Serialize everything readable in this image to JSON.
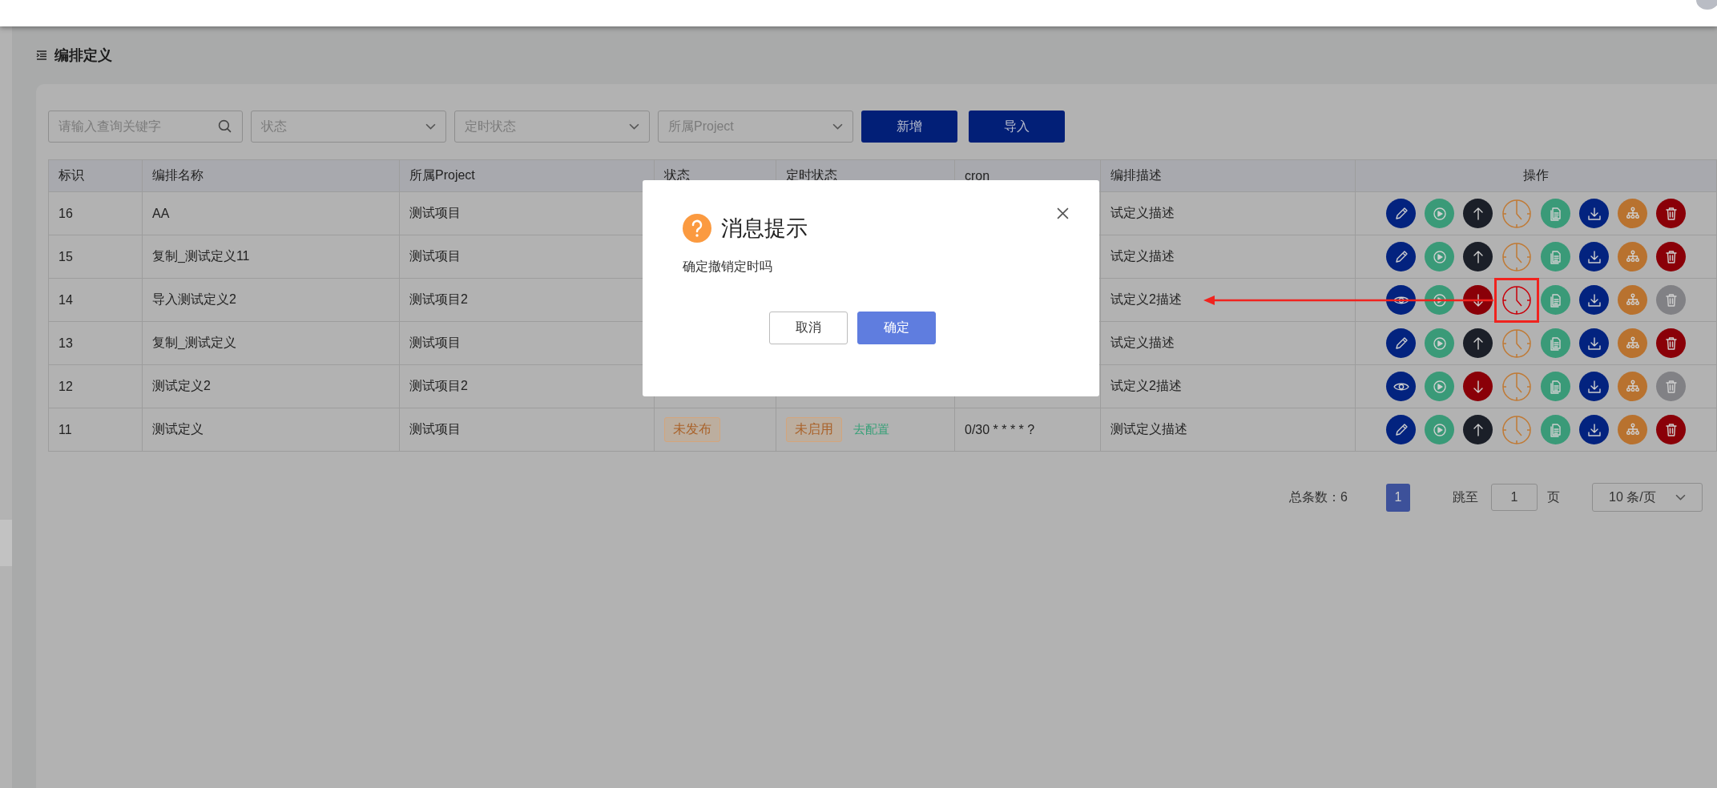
{
  "page_title": "编排定义",
  "filters": {
    "search": {
      "placeholder": "请输入查询关键字"
    },
    "selects": [
      {
        "placeholder": "状态"
      },
      {
        "placeholder": "定时状态"
      },
      {
        "placeholder": "所属Project"
      }
    ]
  },
  "buttons": [
    "新增",
    "导入"
  ],
  "table": {
    "columns": [
      "标识",
      "编排名称",
      "所属Project",
      "状态",
      "定时状态",
      "cron",
      "编排描述",
      "操作"
    ],
    "rows": [
      {
        "id": "16",
        "name": "AA",
        "project": "测试项目",
        "description": "试定义描述",
        "editable": true,
        "published": false,
        "clock_highlighted": false,
        "deletable": true
      },
      {
        "id": "15",
        "name": "复制_测试定义11",
        "project": "测试项目",
        "description": "试定义描述",
        "editable": true,
        "published": false,
        "clock_highlighted": false,
        "deletable": true
      },
      {
        "id": "14",
        "name": "导入测试定义2",
        "project": "测试项目2",
        "description": "试定义2描述",
        "editable": false,
        "published": true,
        "clock_highlighted": true,
        "deletable": false
      },
      {
        "id": "13",
        "name": "复制_测试定义",
        "project": "测试项目",
        "description": "试定义描述",
        "editable": true,
        "published": false,
        "clock_highlighted": false,
        "deletable": true
      },
      {
        "id": "12",
        "name": "测试定义2",
        "project": "测试项目2",
        "description": "试定义2描述",
        "editable": false,
        "published": true,
        "clock_highlighted": false,
        "deletable": false
      },
      {
        "id": "11",
        "name": "测试定义",
        "project": "测试项目",
        "status": "未发布",
        "timer_status": "未启用",
        "timer_link": "去配置",
        "cron": "0/30 * * * * ?",
        "description": "测试定义描述",
        "editable": true,
        "published": false,
        "clock_highlighted": false,
        "deletable": true
      }
    ]
  },
  "pagination": {
    "total": "总条数：6",
    "pages": [
      {
        "label": "1",
        "selected": true
      }
    ],
    "jump_label": "跳至",
    "jump_value": "1",
    "page_suffix": "页",
    "page_size": "10 条/页"
  },
  "dialog": {
    "title": "消息提示",
    "message": "确定撤销定时吗",
    "buttons": [
      {
        "label": "取消",
        "kind": "secondary"
      },
      {
        "label": "确定",
        "kind": "primary"
      }
    ]
  }
}
